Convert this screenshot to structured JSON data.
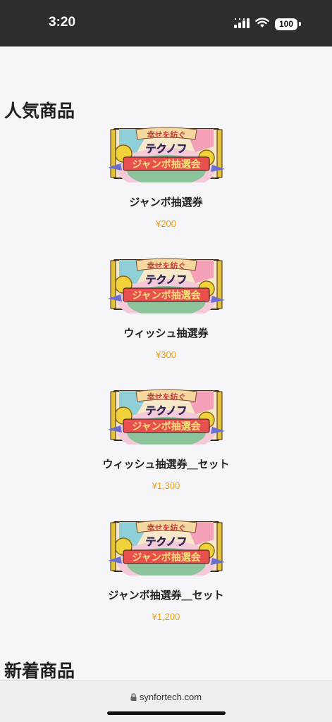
{
  "status": {
    "time": "3:20",
    "battery": "100"
  },
  "sections": {
    "popular_title": "人気商品",
    "new_title": "新着商品"
  },
  "products": [
    {
      "name": "ジャンボ抽選券",
      "price": "¥200"
    },
    {
      "name": "ウィッシュ抽選券",
      "price": "¥300"
    },
    {
      "name": "ウィッシュ抽選券＿セット",
      "price": "¥1,300"
    },
    {
      "name": "ジャンボ抽選券＿セット",
      "price": "¥1,200"
    }
  ],
  "banner": {
    "line1": "幸せを紡ぐ",
    "line2": "テクノフ",
    "line3": "ジャンボ抽選会"
  },
  "browser": {
    "url": "synfortech.com"
  },
  "colors": {
    "price": "#f0a000",
    "status_bg": "#2d2d2d",
    "page_bg": "#f6f6f8"
  }
}
